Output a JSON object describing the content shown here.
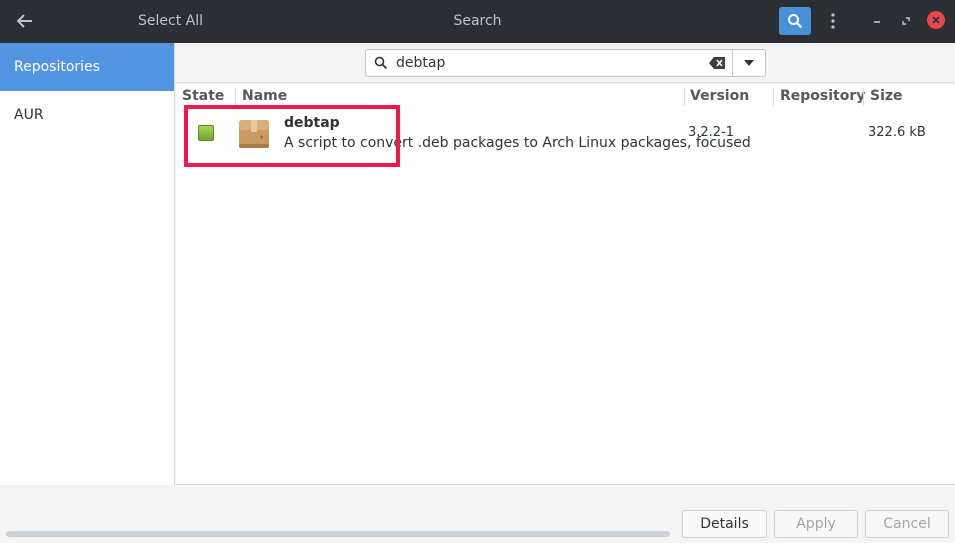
{
  "header": {
    "select_all": "Select All",
    "title": "Search"
  },
  "sidebar": {
    "items": [
      {
        "label": "Repositories",
        "active": true
      },
      {
        "label": "AUR",
        "active": false
      }
    ]
  },
  "search": {
    "value": "debtap"
  },
  "table": {
    "columns": [
      "State",
      "Name",
      "Version",
      "Repository",
      "Size"
    ],
    "rows": [
      {
        "state": "installed",
        "icon": "package-icon",
        "name": "debtap",
        "description": "A script to convert .deb packages to Arch Linux packages, focused",
        "version": "3.2.2-1",
        "repository": "",
        "size": "322.6 kB"
      }
    ]
  },
  "buttons": {
    "details": "Details",
    "apply": "Apply",
    "cancel": "Cancel"
  },
  "colors": {
    "accent": "#5294e2",
    "highlight": "#f0184f",
    "header_bg": "#2b2e33"
  }
}
